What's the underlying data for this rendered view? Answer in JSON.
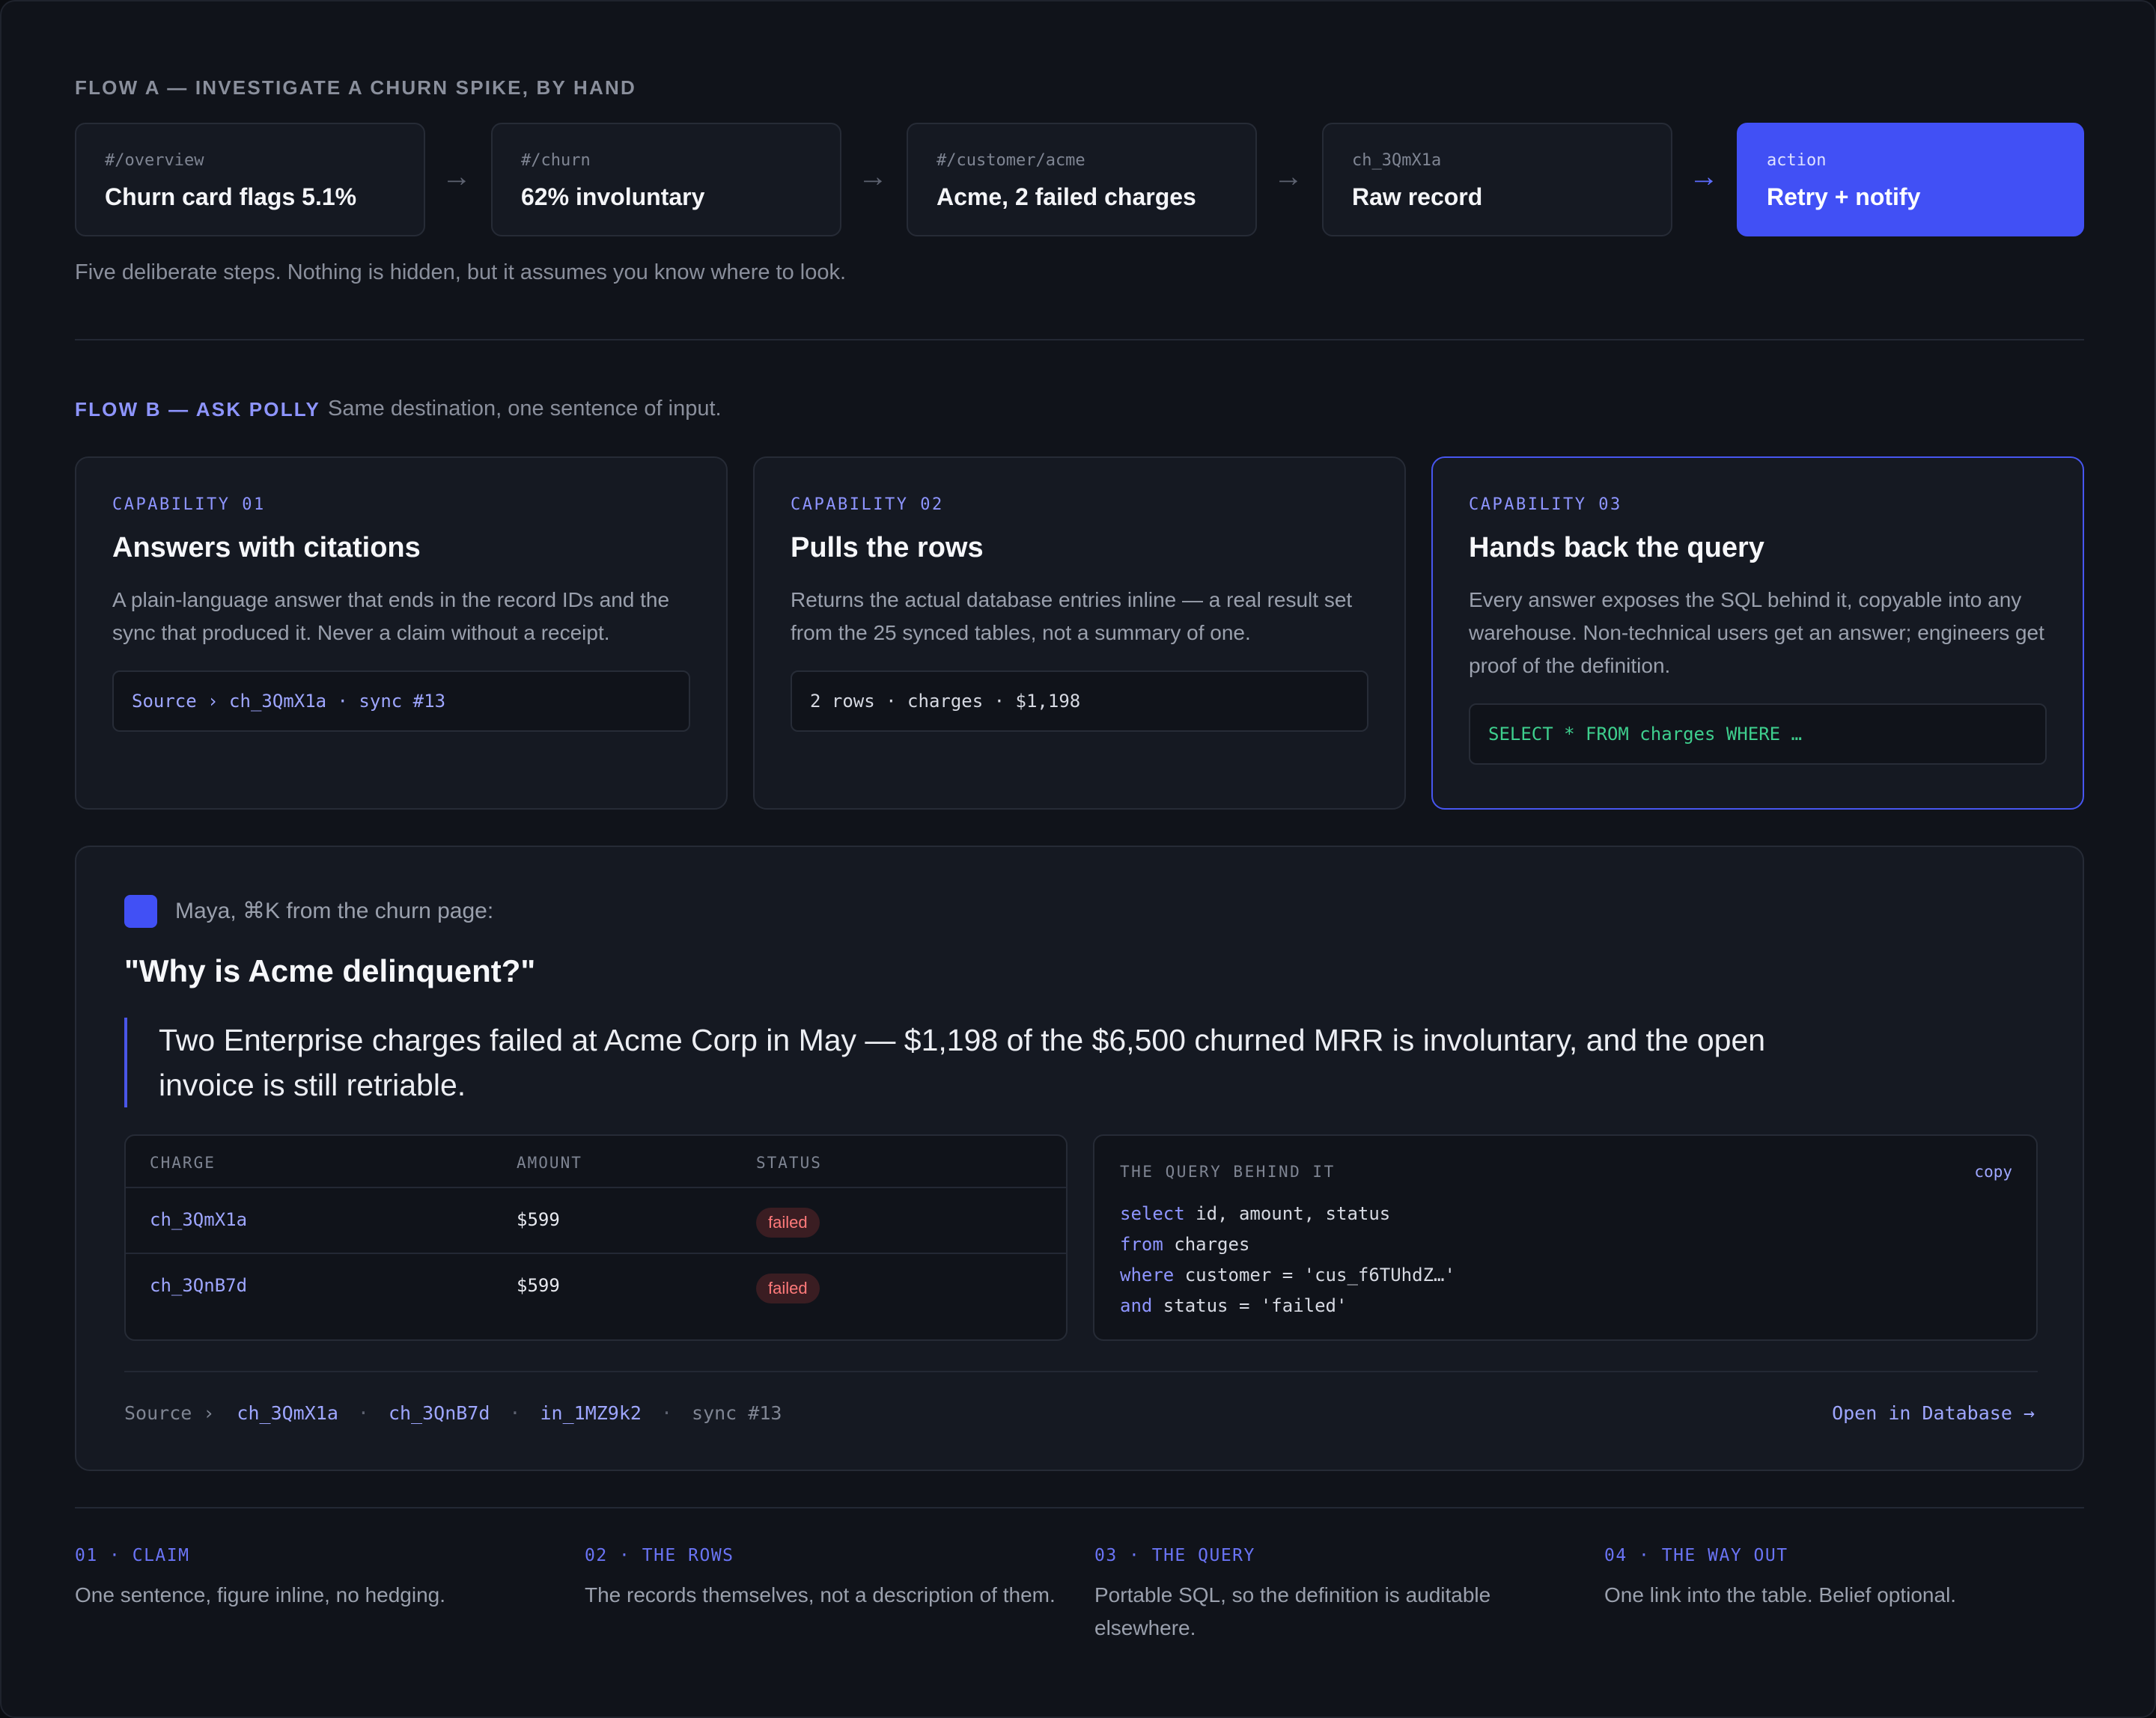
{
  "flow_a": {
    "label": "FLOW A — INVESTIGATE A CHURN SPIKE, BY HAND",
    "steps": [
      {
        "path": "#/overview",
        "title": "Churn card flags 5.1%"
      },
      {
        "path": "#/churn",
        "title": "62% involuntary"
      },
      {
        "path": "#/customer/acme",
        "title": "Acme, 2 failed charges"
      },
      {
        "path": "ch_3QmX1a",
        "title": "Raw record"
      },
      {
        "path": "action",
        "title": "Retry + notify"
      }
    ],
    "arrow": "→",
    "caption": "Five deliberate steps. Nothing is hidden, but it assumes you know where to look."
  },
  "flow_b": {
    "label": "FLOW B — ASK POLLY",
    "subtitle": "Same destination, one sentence of input."
  },
  "capabilities": [
    {
      "tag": "CAPABILITY 01",
      "title": "Answers with citations",
      "desc": "A plain-language answer that ends in the record IDs and the sync that produced it. Never a claim without a receipt.",
      "code": "Source › ch_3QmX1a · sync #13"
    },
    {
      "tag": "CAPABILITY 02",
      "title": "Pulls the rows",
      "desc": "Returns the actual database entries inline — a real result set from the 25 synced tables, not a summary of one.",
      "code": "2 rows · charges · $1,198"
    },
    {
      "tag": "CAPABILITY 03",
      "title": "Hands back the query",
      "desc": "Every answer exposes the SQL behind it, copyable into any warehouse. Non-technical users get an answer; engineers get proof of the definition.",
      "code": "SELECT * FROM charges WHERE …"
    }
  ],
  "conversation": {
    "asker": "Maya, ⌘K from the churn page:",
    "question": "\"Why is Acme delinquent?\"",
    "answer": "Two Enterprise charges failed at Acme Corp in May — $1,198 of the $6,500 churned MRR is involuntary, and the open invoice is still retriable.",
    "table": {
      "headers": [
        "CHARGE",
        "AMOUNT",
        "STATUS"
      ],
      "rows": [
        {
          "charge": "ch_3QmX1a",
          "amount": "$599",
          "status": "failed"
        },
        {
          "charge": "ch_3QnB7d",
          "amount": "$599",
          "status": "failed"
        }
      ]
    },
    "query": {
      "label": "THE QUERY BEHIND IT",
      "copy": "copy",
      "lines": [
        {
          "kw": "select",
          "rest": " id, amount, status"
        },
        {
          "kw": "from",
          "rest": " charges"
        },
        {
          "kw": "where",
          "rest": " customer = 'cus_f6TUhdZ…'"
        },
        {
          "kw": "and",
          "rest": " status = 'failed'"
        }
      ]
    },
    "sources": {
      "prefix": "Source ›",
      "links": [
        "ch_3QmX1a",
        "ch_3QnB7d",
        "in_1MZ9k2"
      ],
      "sync": "sync #13",
      "separator": "·"
    },
    "open_link": "Open in Database →"
  },
  "footer": [
    {
      "tag": "01 · CLAIM",
      "desc": "One sentence, figure inline, no hedging."
    },
    {
      "tag": "02 · THE ROWS",
      "desc": "The records themselves, not a description of them."
    },
    {
      "tag": "03 · THE QUERY",
      "desc": "Portable SQL, so the definition is auditable elsewhere."
    },
    {
      "tag": "04 · THE WAY OUT",
      "desc": "One link into the table. Belief optional."
    }
  ],
  "colors": {
    "accent": "#4150f5",
    "accent_text": "#8e95ff",
    "failed": "#ff7a7a",
    "sql_green": "#3ecf8e"
  }
}
